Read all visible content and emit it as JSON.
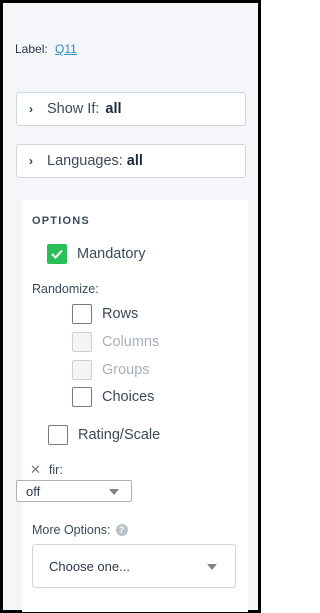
{
  "label": {
    "prefix": "Label:",
    "value": "Q11"
  },
  "show_if": {
    "label": "Show If:",
    "value": "all"
  },
  "languages": {
    "label": "Languages:",
    "value": "all"
  },
  "options": {
    "title": "OPTIONS",
    "mandatory": {
      "label": "Mandatory",
      "checked": true
    },
    "randomize_label": "Randomize:",
    "randomize_items": [
      {
        "label": "Rows",
        "checked": false,
        "disabled": false
      },
      {
        "label": "Columns",
        "checked": false,
        "disabled": true
      },
      {
        "label": "Groups",
        "checked": false,
        "disabled": true
      },
      {
        "label": "Choices",
        "checked": false,
        "disabled": false
      }
    ],
    "rating_scale": {
      "label": "Rating/Scale",
      "checked": false
    }
  },
  "fir": {
    "label": "fir:",
    "select_value": "off"
  },
  "more_options": {
    "label": "More Options:",
    "placeholder": "Choose one..."
  },
  "colors": {
    "accent_check": "#2bbf59",
    "link": "#2a8fc1"
  }
}
